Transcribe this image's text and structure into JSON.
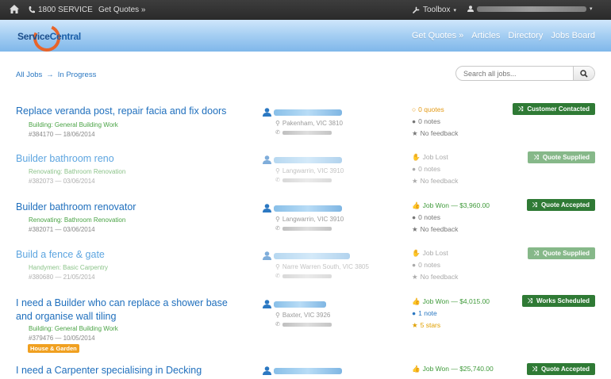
{
  "topbar": {
    "phone": "1800 SERVICE",
    "get_quotes": "Get Quotes »",
    "toolbox": "Toolbox"
  },
  "header": {
    "logo_service": "Service",
    "logo_central": "Central",
    "nav": [
      "Get Quotes »",
      "Articles",
      "Directory",
      "Jobs Board"
    ]
  },
  "breadcrumb": {
    "all_jobs": "All Jobs",
    "arrow": "→",
    "current": "In Progress"
  },
  "search": {
    "placeholder": "Search all jobs..."
  },
  "jobs": [
    {
      "title": "Replace veranda post, repair facia and fix doors",
      "category": "Building: General Building Work",
      "meta": "#384170 — 18/06/2014",
      "location": "Pakenham, VIC 3810",
      "stat1": "0 quotes",
      "stat2": "0 notes",
      "stat3": "No feedback",
      "status": "Customer Contacted"
    },
    {
      "title": "Builder bathroom reno",
      "category": "Renovating: Bathroom Renovation",
      "meta": "#382073 — 03/06/2014",
      "location": "Langwarrin, VIC 3910",
      "stat1": "Job Lost",
      "stat2": "0 notes",
      "stat3": "No feedback",
      "status": "Quote Supplied"
    },
    {
      "title": "Builder bathroom renovator",
      "category": "Renovating: Bathroom Renovation",
      "meta": "#382071 — 03/06/2014",
      "location": "Langwarrin, VIC 3910",
      "stat1": "Job Won — $3,960.00",
      "stat2": "0 notes",
      "stat3": "No feedback",
      "status": "Quote Accepted"
    },
    {
      "title": "Build a fence & gate",
      "category": "Handymen: Basic Carpentry",
      "meta": "#380680 — 21/05/2014",
      "location": "Narre Warren South, VIC 3805",
      "stat1": "Job Lost",
      "stat2": "0 notes",
      "stat3": "No feedback",
      "status": "Quote Supplied"
    },
    {
      "title": "I need a Builder who can replace a shower base and organise wall tiling",
      "category": "Building: General Building Work",
      "meta": "#379476 — 10/05/2014",
      "tag": "House & Garden",
      "location": "Baxter, VIC 3926",
      "stat1": "Job Won — $4,015.00",
      "stat2": "1 note",
      "stat3": "5 stars",
      "status": "Works Scheduled"
    },
    {
      "title": "I need a Carpenter specialising in Decking",
      "stat1": "Job Won — $25,740.00",
      "status": "Quote Accepted"
    }
  ]
}
